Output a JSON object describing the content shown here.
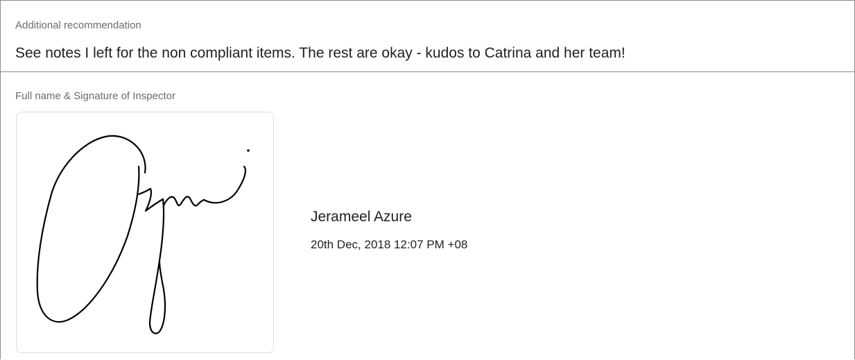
{
  "recommendation": {
    "label": "Additional recommendation",
    "text": "See notes I left for the non compliant items. The rest are okay - kudos to Catrina and her team!"
  },
  "signature_section": {
    "label": "Full name & Signature of Inspector",
    "signature_image": "handwritten-signature",
    "inspector_name": "Jerameel Azure",
    "signed_at": "20th Dec, 2018 12:07 PM +08"
  }
}
